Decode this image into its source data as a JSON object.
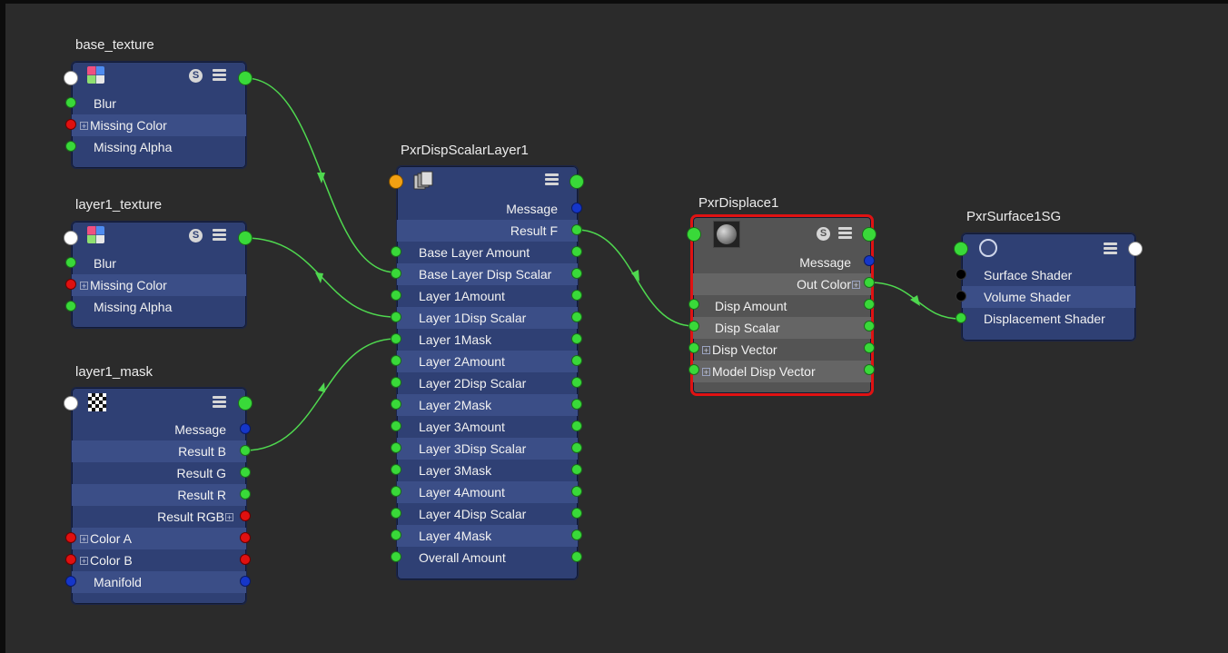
{
  "colors": {
    "canvas": "#2b2b2b",
    "node": "#2f4074",
    "node_alt_row": "#3b4e87",
    "selected_node": "#545454",
    "selected_border": "#e01212",
    "port_green": "#39d939",
    "port_red": "#e01010",
    "port_blue": "#1536c9",
    "port_white": "#ffffff",
    "port_orange": "#f2a012",
    "wire": "#4fd84f"
  },
  "nodes": {
    "base_texture": {
      "title": "base_texture",
      "icons": [
        "texture-icon",
        "solo-icon",
        "menu-icon"
      ],
      "rows": [
        "Blur",
        "Missing Color",
        "Missing Alpha"
      ]
    },
    "layer1_texture": {
      "title": "layer1_texture",
      "icons": [
        "texture-icon",
        "solo-icon",
        "menu-icon"
      ],
      "rows": [
        "Blur",
        "Missing Color",
        "Missing Alpha"
      ]
    },
    "layer1_mask": {
      "title": "layer1_mask",
      "icons": [
        "checker-icon",
        "menu-icon"
      ],
      "rows": [
        "Message",
        "Result B",
        "Result G",
        "Result R",
        "Result RGB",
        "Color A",
        "Color B",
        "Manifold"
      ]
    },
    "disp_scalar_layer": {
      "title": "PxrDispScalarLayer1",
      "icons": [
        "layers-icon",
        "menu-icon"
      ],
      "rows": [
        "Message",
        "Result F",
        "Base Layer Amount",
        "Base Layer Disp Scalar",
        "Layer 1Amount",
        "Layer 1Disp Scalar",
        "Layer 1Mask",
        "Layer 2Amount",
        "Layer 2Disp Scalar",
        "Layer 2Mask",
        "Layer 3Amount",
        "Layer 3Disp Scalar",
        "Layer 3Mask",
        "Layer 4Amount",
        "Layer 4Disp Scalar",
        "Layer 4Mask",
        "Overall Amount"
      ]
    },
    "displace": {
      "title": "PxrDisplace1",
      "selected": true,
      "icons": [
        "sphere-icon",
        "solo-icon",
        "menu-icon"
      ],
      "rows": [
        "Message",
        "Out Color",
        "Disp Amount",
        "Disp Scalar",
        "Disp Vector",
        "Model Disp Vector"
      ]
    },
    "surface_sg": {
      "title": "PxrSurface1SG",
      "icons": [
        "shading-group-icon",
        "menu-icon"
      ],
      "rows": [
        "Surface Shader",
        "Volume Shader",
        "Displacement Shader"
      ]
    }
  },
  "connections": [
    {
      "from": "base_texture.output",
      "to": "PxrDispScalarLayer1.Base Layer Disp Scalar"
    },
    {
      "from": "layer1_texture.output",
      "to": "PxrDispScalarLayer1.Layer 1Disp Scalar"
    },
    {
      "from": "layer1_mask.Result B",
      "to": "PxrDispScalarLayer1.Layer 1Mask"
    },
    {
      "from": "PxrDispScalarLayer1.Result F",
      "to": "PxrDisplace1.Disp Scalar"
    },
    {
      "from": "PxrDisplace1.Out Color",
      "to": "PxrSurface1SG.Displacement Shader"
    }
  ]
}
